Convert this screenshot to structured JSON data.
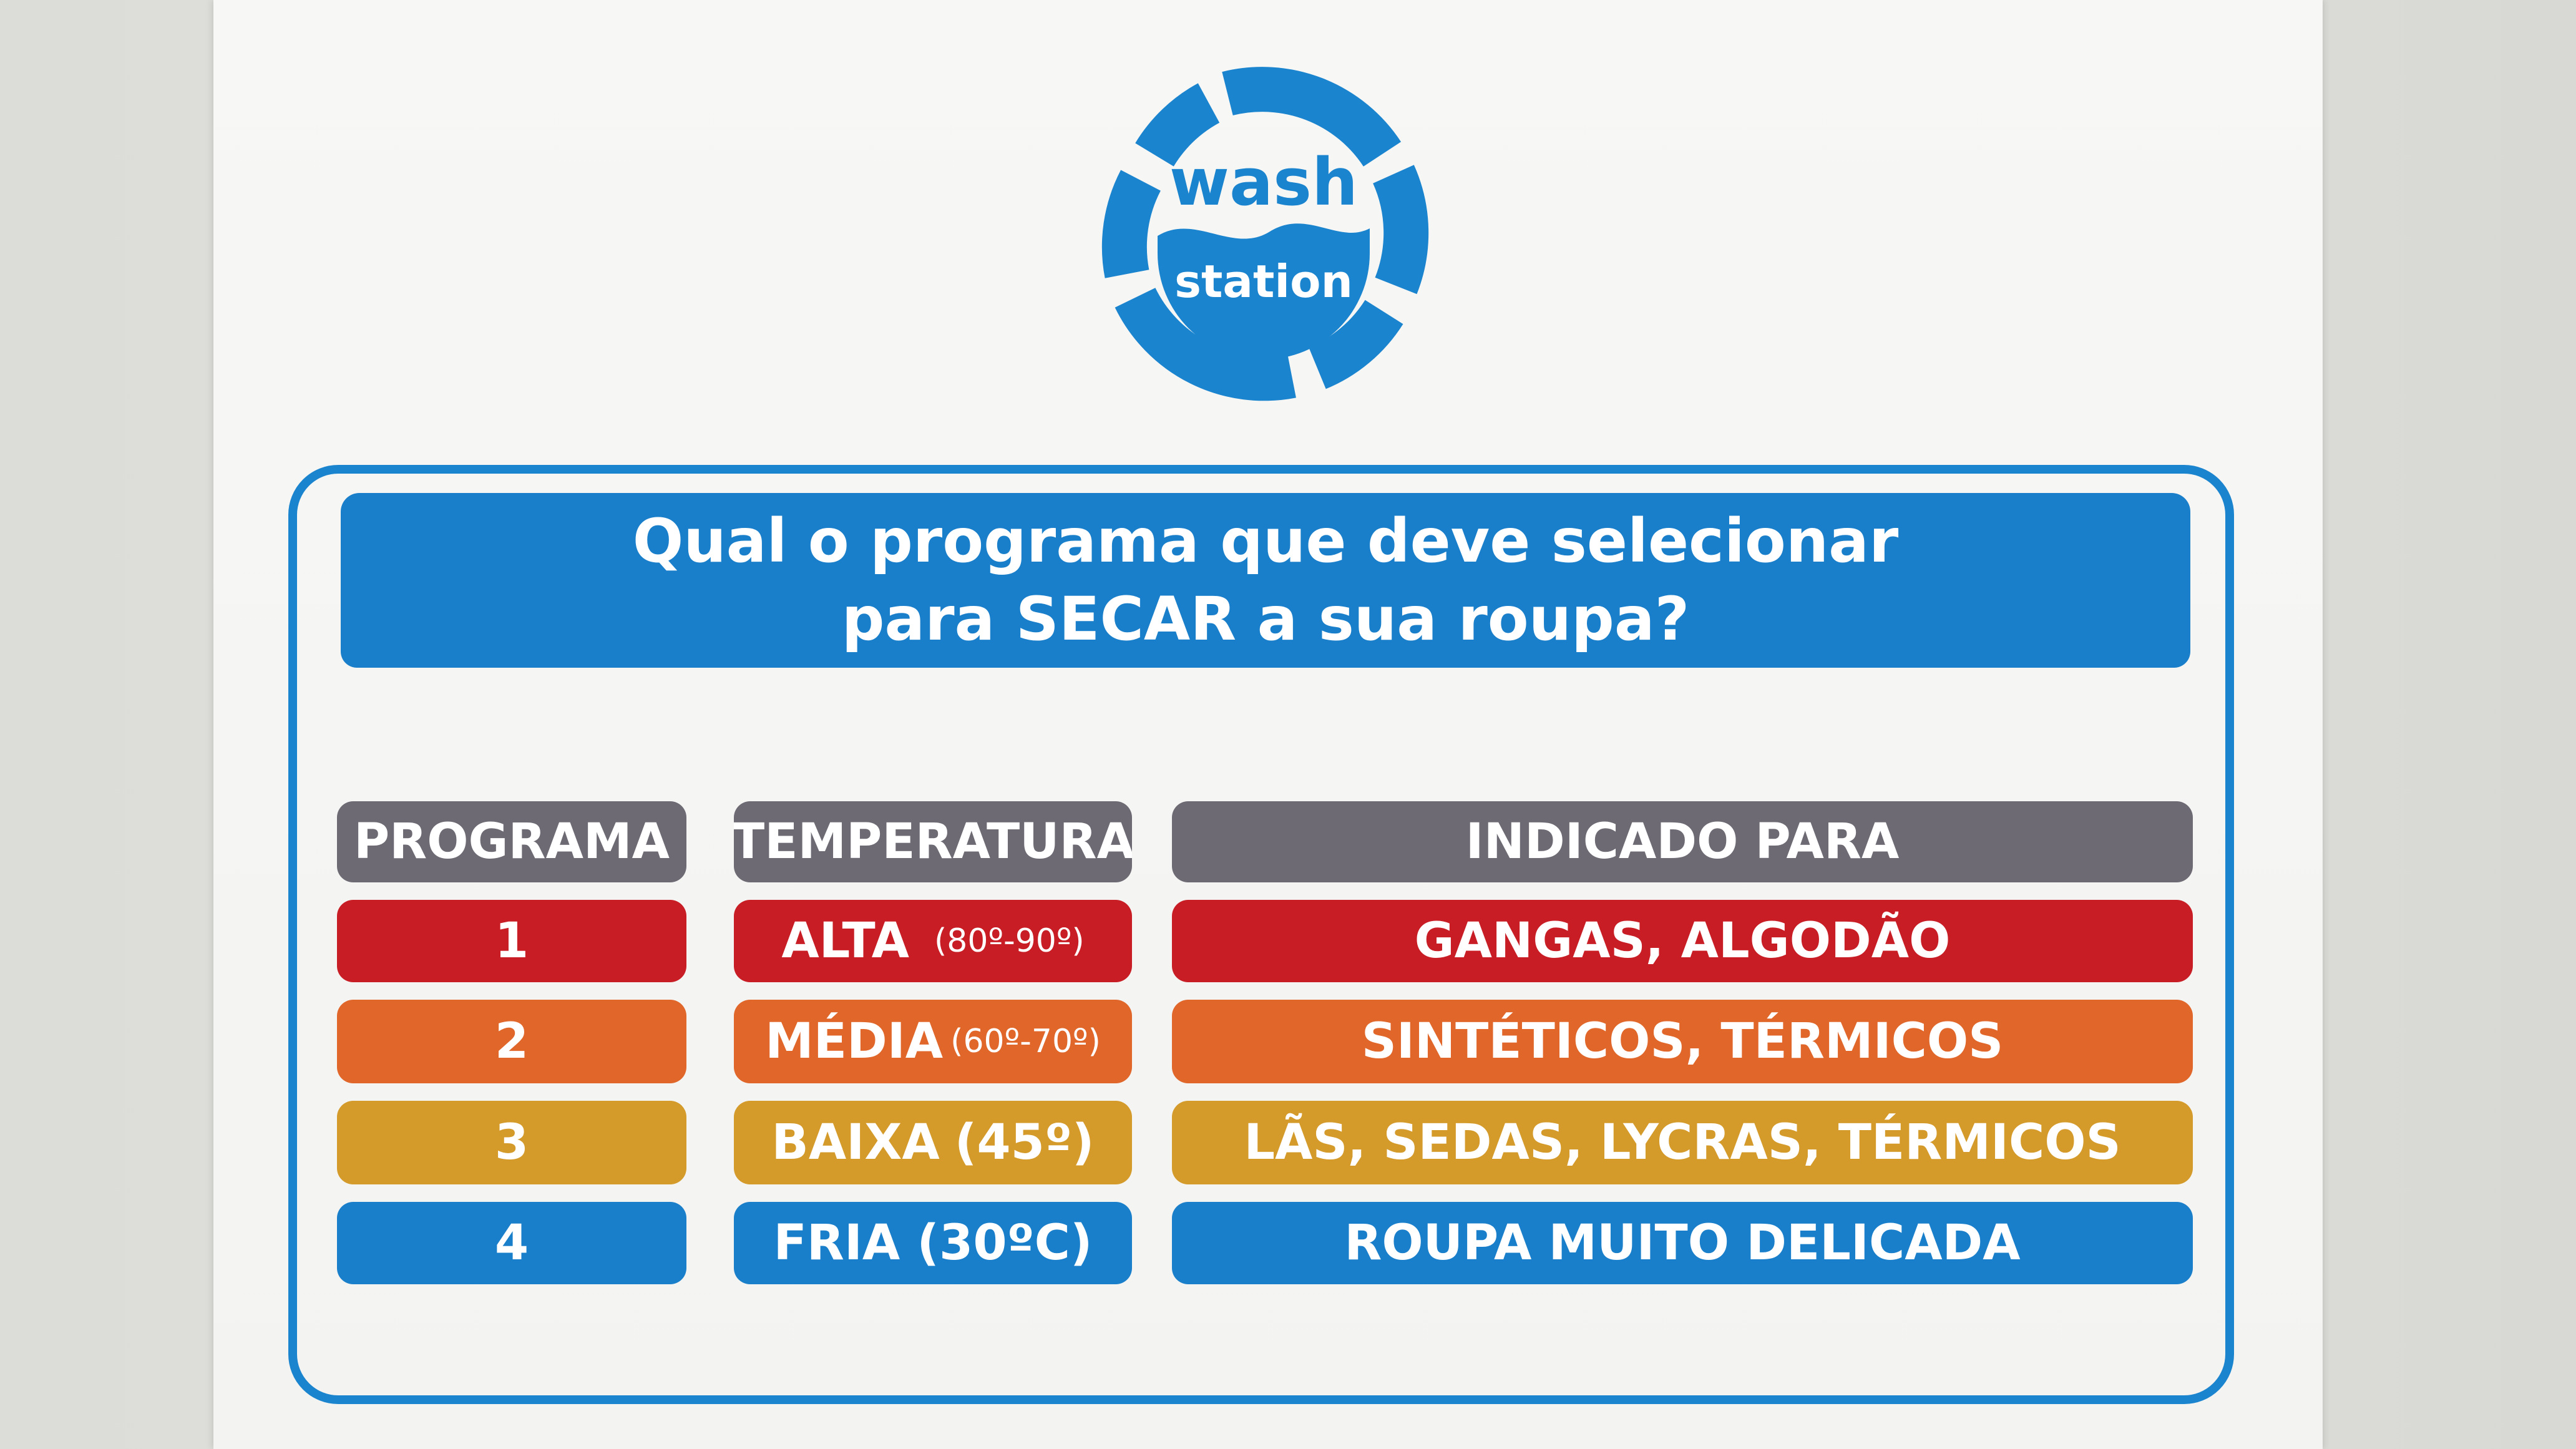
{
  "logo": {
    "line1": "wash",
    "line2": "station",
    "color": "#1b84cf"
  },
  "header": {
    "line1": "Qual o programa que deve selecionar",
    "line2": "para SECAR a sua roupa?",
    "background": "#1a7fca"
  },
  "columns": {
    "programa": "PROGRAMA",
    "temperatura": "TEMPERATURA",
    "indicado": "INDICADO PARA",
    "background": "#6d6a73"
  },
  "rows": [
    {
      "programa": "1",
      "temperatura": "ALTA",
      "range": "(80º-90º)",
      "indicado": "GANGAS, ALGODÃO",
      "color": "#c81d25"
    },
    {
      "programa": "2",
      "temperatura": "MÉDIA",
      "range": "(60º-70º)",
      "indicado": "SINTÉTICOS, TÉRMICOS",
      "color": "#e0662a"
    },
    {
      "programa": "3",
      "temperatura": "BAIXA",
      "range": "(45º)",
      "indicado": "LÃS, SEDAS, LYCRAS, TÉRMICOS",
      "color": "#d49a2a"
    },
    {
      "programa": "4",
      "temperatura": "FRIA (30ºC)",
      "range": "",
      "indicado": "ROUPA MUITO DELICADA",
      "color": "#1a7fca"
    }
  ]
}
